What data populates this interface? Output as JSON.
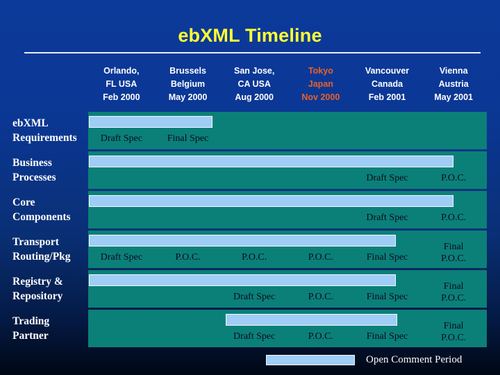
{
  "slide": {
    "title": "ebXML Timeline",
    "background_color": "#0a3490",
    "title_color": "#ffff33",
    "track_color": "#0b8078",
    "bar_color": "#9fcdf5",
    "accent_color": "#e8622a"
  },
  "headers": [
    {
      "city": "Orlando,",
      "region": "FL USA",
      "date": "Feb 2000",
      "highlight": false
    },
    {
      "city": "Brussels",
      "region": "Belgium",
      "date": "May 2000",
      "highlight": false
    },
    {
      "city": "San Jose,",
      "region": "CA USA",
      "date": "Aug 2000",
      "highlight": false
    },
    {
      "city": "Tokyo",
      "region": "Japan",
      "date": "Nov 2000",
      "highlight": true
    },
    {
      "city": "Vancouver",
      "region": "Canada",
      "date": "Feb 2001",
      "highlight": false
    },
    {
      "city": "Vienna",
      "region": "Austria",
      "date": "May 2001",
      "highlight": false
    }
  ],
  "rows": [
    {
      "label_line1": "ebXML",
      "label_line2": "Requirements",
      "bar_start_pct": 0.2,
      "bar_width_pct": 31.0,
      "marks": [
        "Draft Spec",
        "Final Spec",
        "",
        "",
        "",
        ""
      ]
    },
    {
      "label_line1": "Business",
      "label_line2": "Processes",
      "bar_start_pct": 0.2,
      "bar_width_pct": 91.5,
      "marks": [
        "",
        "",
        "",
        "",
        "Draft Spec",
        "P.O.C."
      ]
    },
    {
      "label_line1": "Core",
      "label_line2": "Components",
      "bar_start_pct": 0.2,
      "bar_width_pct": 91.5,
      "marks": [
        "",
        "",
        "",
        "",
        "Draft Spec",
        "P.O.C."
      ]
    },
    {
      "label_line1": "Transport",
      "label_line2": "Routing/Pkg",
      "bar_start_pct": 0.2,
      "bar_width_pct": 77.0,
      "marks": [
        "Draft Spec",
        "P.O.C.",
        "P.O.C.",
        "P.O.C.",
        "Final Spec",
        "Final|P.O.C."
      ]
    },
    {
      "label_line1": "Registry &",
      "label_line2": "Repository",
      "bar_start_pct": 0.2,
      "bar_width_pct": 77.0,
      "marks": [
        "",
        "",
        "Draft Spec",
        "P.O.C.",
        "Final Spec",
        "Final|P.O.C."
      ]
    },
    {
      "label_line1": "Trading",
      "label_line2": "Partner",
      "bar_start_pct": 34.5,
      "bar_width_pct": 43.0,
      "marks": [
        "",
        "",
        "Draft Spec",
        "P.O.C.",
        "Final Spec",
        "Final|P.O.C."
      ]
    }
  ],
  "legend": {
    "label": "Open Comment Period"
  }
}
